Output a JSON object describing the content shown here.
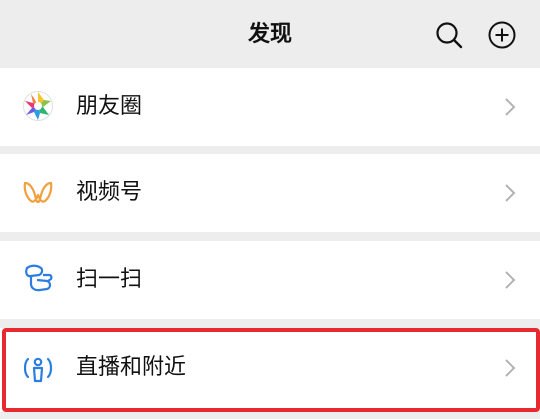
{
  "header": {
    "title": "发现",
    "search_icon": "search-icon",
    "add_icon": "plus-circle-icon"
  },
  "items": [
    {
      "label": "朋友圈",
      "icon": "moments-icon"
    },
    {
      "label": "视频号",
      "icon": "channels-icon"
    },
    {
      "label": "扫一扫",
      "icon": "scan-icon"
    },
    {
      "label": "直播和附近",
      "icon": "live-nearby-icon"
    }
  ],
  "colors": {
    "background": "#ededed",
    "row_background": "#ffffff",
    "highlight_border": "#e8292f",
    "channels_accent": "#f0a03c",
    "scan_blue": "#2b7de0"
  }
}
